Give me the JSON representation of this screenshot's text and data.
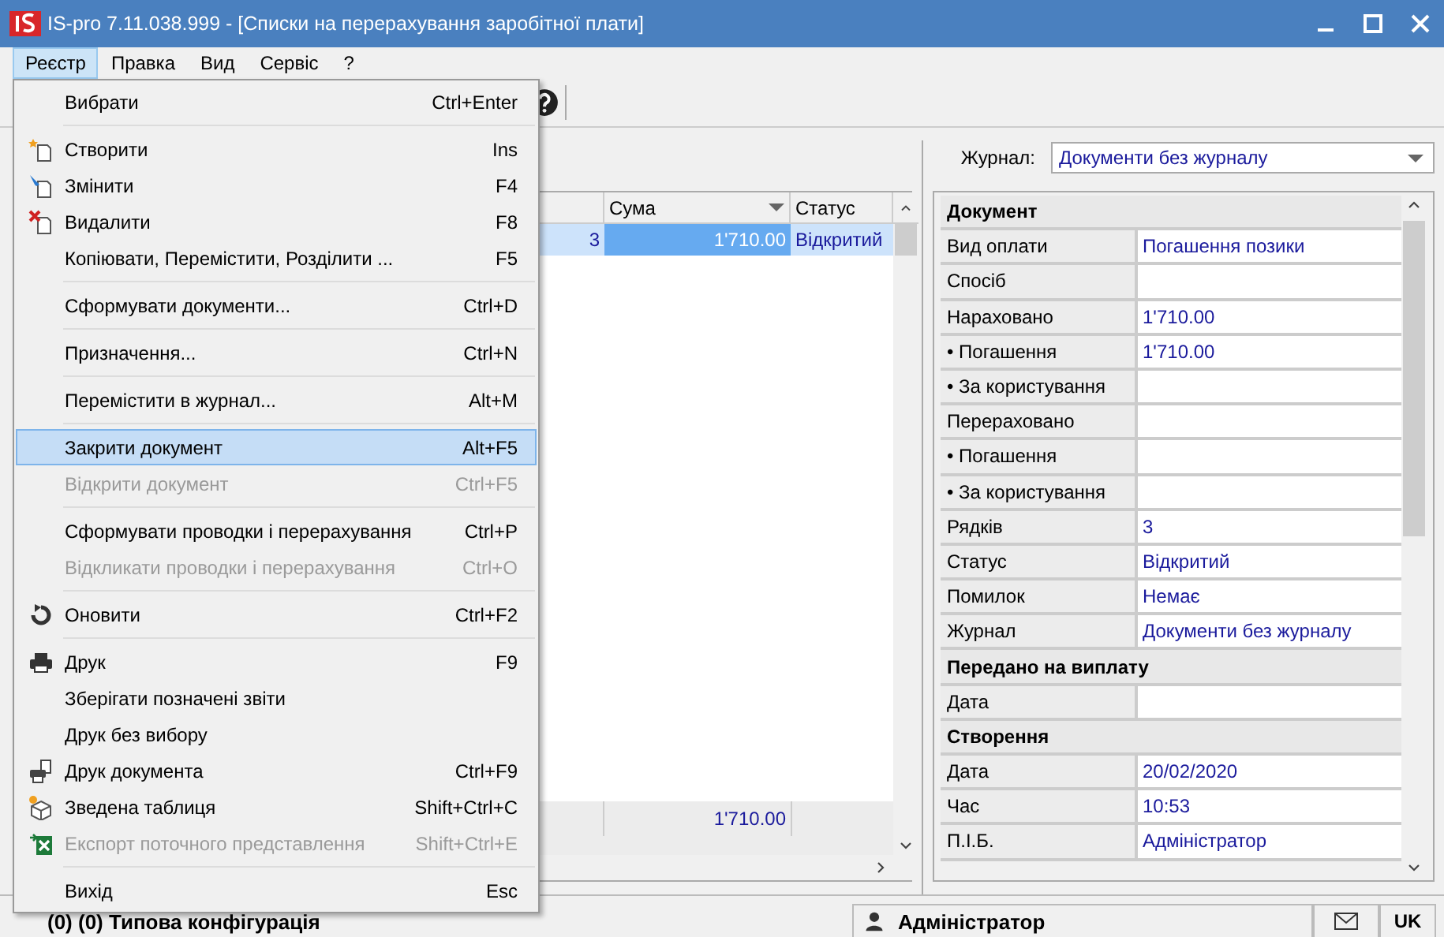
{
  "window": {
    "title": "IS-pro 7.11.038.999 - [Списки на перерахування заробітної плати]"
  },
  "menubar": [
    {
      "label": "Реєстр",
      "selected": true
    },
    {
      "label": "Правка",
      "selected": false
    },
    {
      "label": "Вид",
      "selected": false
    },
    {
      "label": "Сервіс",
      "selected": false
    },
    {
      "label": "?",
      "selected": false
    }
  ],
  "menu": [
    {
      "label": "Вибрати",
      "shortcut": "Ctrl+Enter",
      "kind": "plain",
      "disabled": false,
      "selected": false,
      "separator_after": true
    },
    {
      "label": "Створити",
      "shortcut": "Ins",
      "kind": "create",
      "disabled": false,
      "selected": false,
      "separator_after": false
    },
    {
      "label": "Змінити",
      "shortcut": "F4",
      "kind": "edit",
      "disabled": false,
      "selected": false,
      "separator_after": false
    },
    {
      "label": "Видалити",
      "shortcut": "F8",
      "kind": "delete",
      "disabled": false,
      "selected": false,
      "separator_after": false
    },
    {
      "label": "Копіювати, Перемістити, Розділити ...",
      "shortcut": "F5",
      "kind": "plain",
      "disabled": false,
      "selected": false,
      "separator_after": true
    },
    {
      "label": "Сформувати документи...",
      "shortcut": "Ctrl+D",
      "kind": "plain",
      "disabled": false,
      "selected": false,
      "separator_after": true
    },
    {
      "label": "Призначення...",
      "shortcut": "Ctrl+N",
      "kind": "plain",
      "disabled": false,
      "selected": false,
      "separator_after": true
    },
    {
      "label": "Перемістити в журнал...",
      "shortcut": "Alt+M",
      "kind": "plain",
      "disabled": false,
      "selected": false,
      "separator_after": true
    },
    {
      "label": "Закрити документ",
      "shortcut": "Alt+F5",
      "kind": "plain",
      "disabled": false,
      "selected": true,
      "separator_after": false
    },
    {
      "label": "Відкрити документ",
      "shortcut": "Ctrl+F5",
      "kind": "plain",
      "disabled": true,
      "selected": false,
      "separator_after": true
    },
    {
      "label": "Сформувати проводки і перерахування",
      "shortcut": "Ctrl+P",
      "kind": "plain",
      "disabled": false,
      "selected": false,
      "separator_after": false
    },
    {
      "label": "Відкликати проводки і перерахування",
      "shortcut": "Ctrl+O",
      "kind": "plain",
      "disabled": true,
      "selected": false,
      "separator_after": true
    },
    {
      "label": "Оновити",
      "shortcut": "Ctrl+F2",
      "kind": "refresh",
      "disabled": false,
      "selected": false,
      "separator_after": true
    },
    {
      "label": "Друк",
      "shortcut": "F9",
      "kind": "print",
      "disabled": false,
      "selected": false,
      "separator_after": false
    },
    {
      "label": "Зберігати позначені звіти",
      "kind": "plain",
      "disabled": false,
      "selected": false,
      "separator_after": false
    },
    {
      "label": "Друк без вибору",
      "kind": "plain",
      "disabled": false,
      "selected": false,
      "separator_after": false
    },
    {
      "label": "Друк документа",
      "shortcut": "Ctrl+F9",
      "kind": "print-document",
      "disabled": false,
      "selected": false,
      "separator_after": false
    },
    {
      "label": "Зведена таблиця",
      "shortcut": "Shift+Ctrl+C",
      "kind": "pivot",
      "disabled": false,
      "selected": false,
      "separator_after": false
    },
    {
      "label": "Експорт поточного представлення",
      "shortcut": "Shift+Ctrl+E",
      "kind": "export",
      "disabled": true,
      "selected": false,
      "separator_after": true
    },
    {
      "label": "Вихід",
      "shortcut": "Esc",
      "kind": "plain",
      "disabled": false,
      "selected": false,
      "separator_after": false
    }
  ],
  "journal": {
    "label": "Журнал:",
    "value": "Документи без журналу"
  },
  "table": {
    "columns": [
      "Сума",
      "Статус"
    ],
    "rows": [
      {
        "column_1": "3",
        "sum": "1'710.00",
        "status": "Відкритий",
        "selected": true
      }
    ],
    "footer": {
      "sum": "1'710.00"
    }
  },
  "properties": [
    {
      "kind": "section",
      "label": "Документ"
    },
    {
      "kind": "field",
      "label": "Вид оплати",
      "value": "Погашення позики"
    },
    {
      "kind": "field",
      "label": "Спосіб"
    },
    {
      "kind": "field",
      "label": "Нараховано",
      "value": "1'710.00"
    },
    {
      "kind": "field",
      "label": "• Погашення",
      "value": "1'710.00"
    },
    {
      "kind": "field",
      "label": "• За користування"
    },
    {
      "kind": "field",
      "label": "Перераховано"
    },
    {
      "kind": "field",
      "label": "• Погашення"
    },
    {
      "kind": "field",
      "label": "• За користування"
    },
    {
      "kind": "field",
      "label": "Рядків",
      "value": "3"
    },
    {
      "kind": "field",
      "label": "Статус",
      "value": "Відкритий"
    },
    {
      "kind": "field",
      "label": "Помилок",
      "value": "Немає"
    },
    {
      "kind": "field",
      "label": "Журнал",
      "value": "Документи без журналу"
    },
    {
      "kind": "section",
      "label": "Передано на виплату"
    },
    {
      "kind": "field",
      "label": "Дата"
    },
    {
      "kind": "section",
      "label": "Створення"
    },
    {
      "kind": "field",
      "label": "Дата",
      "value": "20/02/2020"
    },
    {
      "kind": "field",
      "label": "Час",
      "value": "10:53"
    },
    {
      "kind": "field",
      "label": "П.І.Б.",
      "value": "Адміністратор"
    }
  ],
  "status_bar": {
    "configuration": "(0) (0) Типова конфігурація",
    "user": "Адміністратор",
    "language": "UK"
  }
}
